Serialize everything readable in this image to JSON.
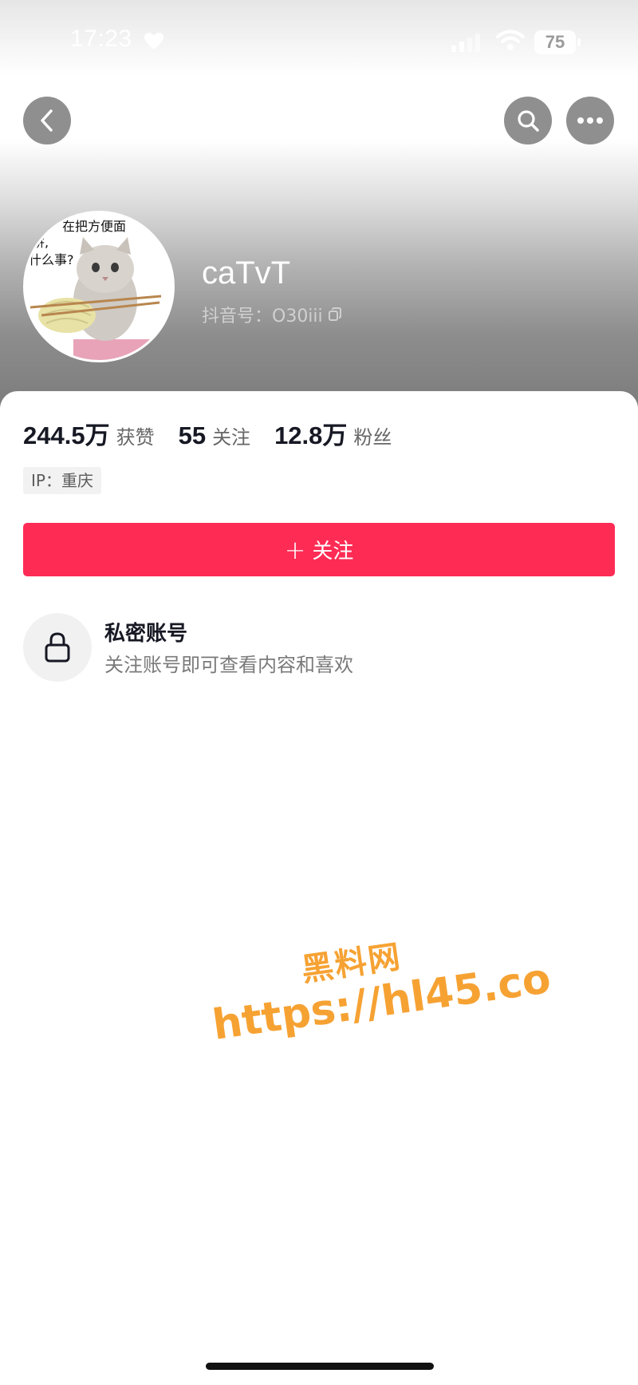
{
  "status_bar": {
    "time": "17:23",
    "battery": "75",
    "icons": [
      "heart-icon",
      "signal-icon",
      "wifi-icon",
      "battery-icon"
    ]
  },
  "nav": {
    "icons": [
      "back-arrow-icon",
      "search-icon",
      "more-icon"
    ]
  },
  "profile": {
    "avatar_caption_lines": [
      "在把方便面",
      "饼,",
      "什么事?"
    ],
    "username": "caTvT",
    "douyin_id": "抖音号：O30iii",
    "copy_icon": "copy-icon"
  },
  "stats": [
    {
      "value": "244.5万",
      "label": "获赞"
    },
    {
      "value": "55",
      "label": "关注"
    },
    {
      "value": "12.8万",
      "label": "粉丝"
    }
  ],
  "ip_tag": "IP：重庆",
  "follow_button": {
    "plus": "+",
    "label": "关注"
  },
  "private_account": {
    "icon": "lock-icon",
    "title": "私密账号",
    "description": "关注账号即可查看内容和喜欢"
  },
  "watermark": {
    "line1": "黑料网",
    "line2": "https://hl45.co"
  },
  "colors": {
    "accent": "#fe2c55",
    "watermark": "#f6a233"
  }
}
